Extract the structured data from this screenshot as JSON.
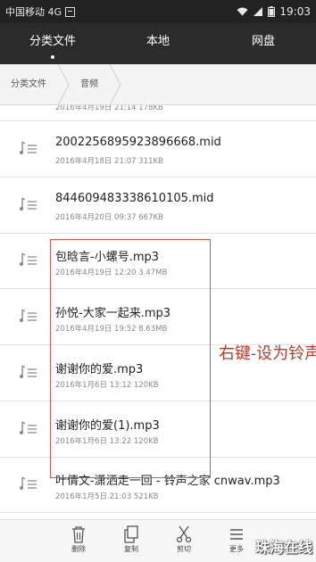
{
  "status_bar": {
    "carrier": "中国移动 4G",
    "time": "19:03"
  },
  "top_tabs": [
    {
      "label": "分类文件",
      "active": true
    },
    {
      "label": "本地",
      "active": false
    },
    {
      "label": "网盘",
      "active": false
    }
  ],
  "breadcrumb": [
    "分类文件",
    "音频"
  ],
  "files": [
    {
      "name": "",
      "meta": "2016年4月19日 21:14 178KB"
    },
    {
      "name": "2002256895923896668.mid",
      "meta": "2016年4月18日 21:07 311KB"
    },
    {
      "name": "844609483338610105.mid",
      "meta": "2016年4月20日 09:37 667KB"
    },
    {
      "name": "包晗言-小螺号.mp3",
      "meta": "2016年4月19日 12:20 3.47MB"
    },
    {
      "name": "孙悦-大家一起来.mp3",
      "meta": "2016年4月19日 19:52 8.63MB"
    },
    {
      "name": "谢谢你的爱.mp3",
      "meta": "2016年1月6日 13:12 120KB"
    },
    {
      "name": "谢谢你的爱(1).mp3",
      "meta": "2016年1月6日 13:22 120KB"
    },
    {
      "name": "叶倩文-潇洒走一回 - 铃声之家 cnwav.mp3",
      "meta": "2016年1月5日 21:03 521KB"
    }
  ],
  "annotation": "右键-设为铃声",
  "actions": [
    {
      "label": "删除",
      "icon": "trash-icon"
    },
    {
      "label": "复制",
      "icon": "copy-icon"
    },
    {
      "label": "剪切",
      "icon": "scissors-icon"
    },
    {
      "label": "更多",
      "icon": "more-icon"
    }
  ],
  "watermark": "珠海在线",
  "colors": {
    "status_bar": "#222222",
    "nav_bar": "#2b2b2b",
    "highlight": "#d9534f",
    "annotation": "#c0392b"
  }
}
